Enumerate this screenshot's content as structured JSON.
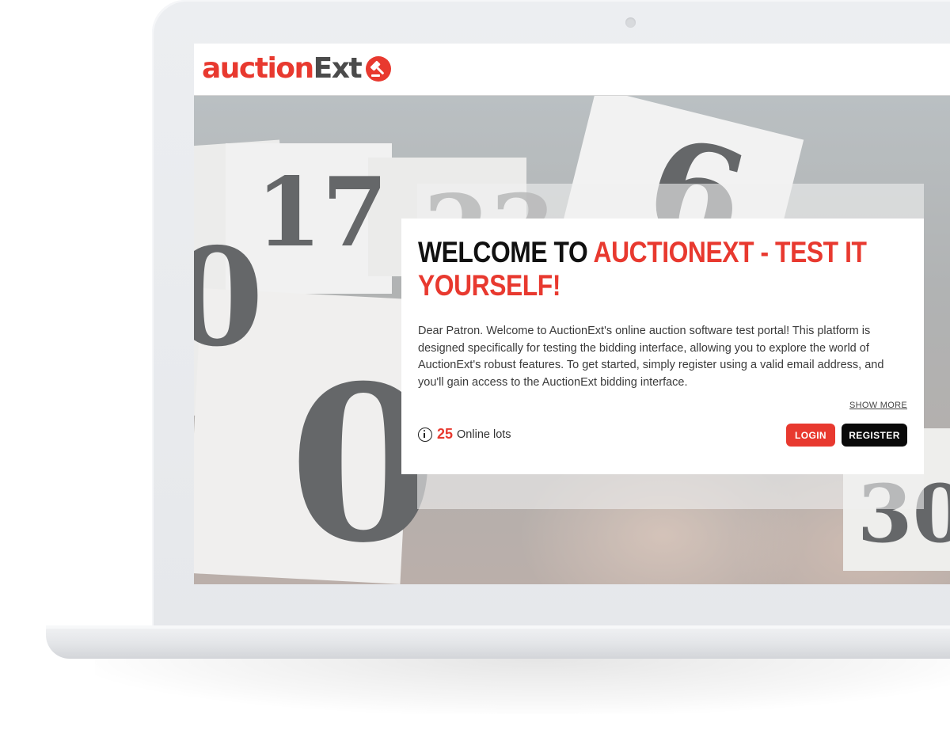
{
  "brand": {
    "logo_part1": "auction",
    "logo_part2": "Ext",
    "primary_color": "#e8392f",
    "dark_color": "#4b4b4b"
  },
  "hero": {
    "title_part1": "WELCOME TO ",
    "title_part2": "AUCTIONEXT - TEST IT YOURSELF!",
    "body": "Dear Patron. Welcome to AuctionExt's online auction software test portal! This platform is designed specifically for testing the bidding interface, allowing you to explore the world of AuctionExt's robust features. To get started, simply register using a valid email address, and you'll gain access to the AuctionExt bidding interface.",
    "show_more": "SHOW MORE",
    "lots_count": "25",
    "lots_label": "Online lots",
    "login_label": "LOGIN",
    "register_label": "REGISTER",
    "background_digits": [
      "17",
      "23",
      "6",
      "0",
      "30"
    ]
  },
  "icons": {
    "logo_mark": "gavel-circle-icon",
    "lots_info": "info-circle-icon"
  }
}
